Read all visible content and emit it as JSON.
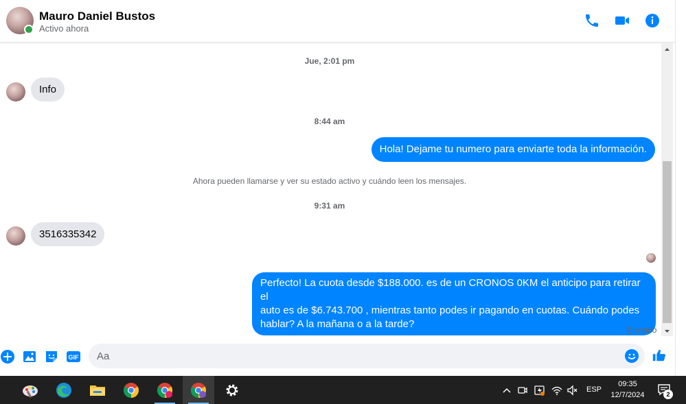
{
  "header": {
    "name": "Mauro Daniel Bustos",
    "status": "Activo ahora"
  },
  "conversation": {
    "timestamps": [
      "Jue, 2:01 pm",
      "8:44 am",
      "9:31 am"
    ],
    "system_message": "Ahora pueden llamarse y ver su estado activo y cuándo leen los mensajes.",
    "messages": [
      {
        "from": "them",
        "text": "Info"
      },
      {
        "from": "me",
        "text": "Hola! Dejame tu numero  para enviarte toda la información."
      },
      {
        "from": "them",
        "text": "3516335342"
      },
      {
        "from": "me",
        "line1": "Perfecto! La cuota desde $188.000. es de un CRONOS 0KM el anticipo para retirar el",
        "line2": "auto es de $6.743.700 , mientras tanto podes ir pagando en cuotas. Cuándo podes",
        "line3": "hablar? A la mañana o a la tarde?"
      }
    ],
    "sent_status": "Enviado"
  },
  "composer": {
    "placeholder": "Aa",
    "gif_label": "GIF"
  },
  "taskbar": {
    "language": "ESP",
    "time": "09:35",
    "date": "12/7/2024",
    "notification_count": "2"
  },
  "colors": {
    "accent": "#0084ff",
    "incoming_bubble": "#e4e6eb",
    "online": "#31a24c"
  }
}
